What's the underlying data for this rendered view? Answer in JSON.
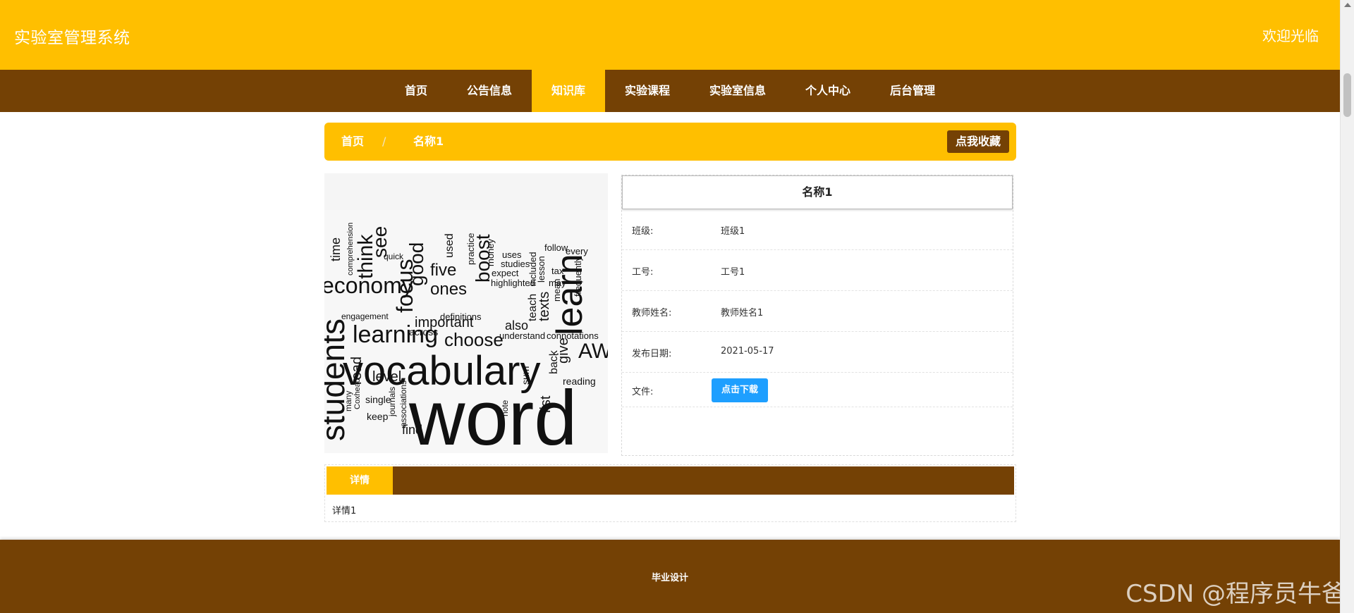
{
  "header": {
    "title": "实验室管理系统",
    "welcome": "欢迎光临"
  },
  "nav": {
    "items": [
      {
        "label": "首页"
      },
      {
        "label": "公告信息"
      },
      {
        "label": "知识库",
        "active": true
      },
      {
        "label": "实验课程"
      },
      {
        "label": "实验室信息"
      },
      {
        "label": "个人中心"
      },
      {
        "label": "后台管理"
      }
    ]
  },
  "breadcrumb": {
    "home": "首页",
    "separator": "/",
    "current": "名称1",
    "favorite_button": "点我收藏"
  },
  "cover": {
    "word_cloud": [
      "word",
      "vocabulary",
      "learning",
      "economy",
      "students",
      "focus",
      "learn",
      "choose",
      "important",
      "boost",
      "five",
      "ones",
      "good",
      "think",
      "see",
      "time",
      "AWL",
      "give",
      "list",
      "find",
      "keep",
      "single",
      "level",
      "read",
      "texts",
      "teach",
      "also",
      "understand",
      "connotations",
      "definitions",
      "across",
      "used",
      "practice",
      "money",
      "uses",
      "studies",
      "expect",
      "highlighted",
      "follow",
      "every",
      "included",
      "lesson",
      "tax",
      "may",
      "mean",
      "frequently",
      "engagement",
      "comprehension",
      "quick",
      "journals",
      "associations",
      "note",
      "sum",
      "back",
      "reading",
      "many",
      "Coxhead"
    ]
  },
  "info": {
    "title": "名称1",
    "rows": [
      {
        "label": "班级:",
        "value": "班级1"
      },
      {
        "label": "工号:",
        "value": "工号1"
      },
      {
        "label": "教师姓名:",
        "value": "教师姓名1"
      },
      {
        "label": "发布日期:",
        "value": "2021-05-17"
      }
    ],
    "file_label": "文件:",
    "download_button": "点击下载"
  },
  "detail": {
    "tab_label": "详情",
    "content": "详情1"
  },
  "footer": {
    "text": "毕业设计",
    "watermark": "CSDN @程序员牛爸"
  },
  "colors": {
    "primary_yellow": "#FFBF00",
    "primary_brown": "#744105",
    "download_blue": "#1E9FFF"
  }
}
